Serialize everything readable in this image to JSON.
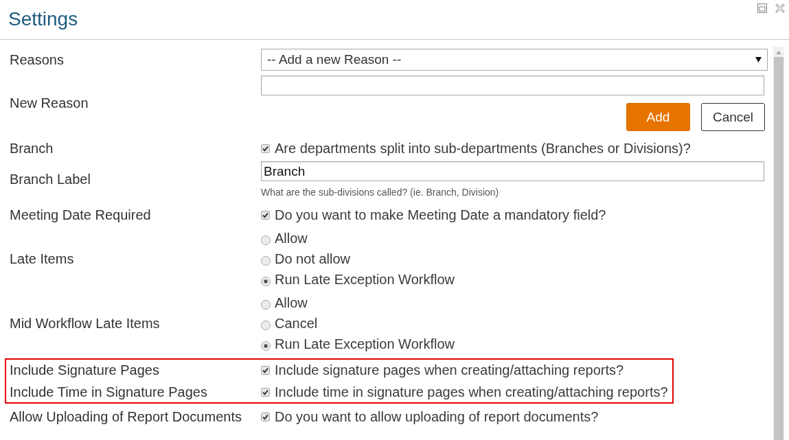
{
  "window": {
    "title": "Settings"
  },
  "settings": [
    {
      "kind": "select",
      "label": "Reasons",
      "value": "-- Add a new Reason --",
      "highlighted": false
    },
    {
      "kind": "add_field",
      "label": "New Reason",
      "buttons": [
        {
          "label": "Add",
          "kind": "primary"
        },
        {
          "label": "Cancel",
          "kind": "secondary"
        }
      ],
      "highlighted": false
    },
    {
      "kind": "checkbox",
      "label": "Branch",
      "text": "Are departments split into sub-departments (Branches or Divisions)?",
      "checked": true,
      "highlighted": false
    },
    {
      "kind": "text",
      "label": "Branch Label",
      "value": "Branch",
      "hint": "What are the sub-divisions called? (ie. Branch, Division)",
      "highlighted": false
    },
    {
      "kind": "checkbox",
      "label": "Meeting Date Required",
      "text": "Do you want to make Meeting Date a mandatory field?",
      "checked": true,
      "highlighted": false
    },
    {
      "kind": "radio",
      "label": "Late Items",
      "options": [
        {
          "label": "Allow",
          "selected": false
        },
        {
          "label": "Do not allow",
          "selected": false
        },
        {
          "label": "Run Late Exception Workflow",
          "selected": true
        }
      ],
      "highlighted": false
    },
    {
      "kind": "radio",
      "label": "Mid Workflow Late Items",
      "options": [
        {
          "label": "Allow",
          "selected": false
        },
        {
          "label": "Cancel",
          "selected": false
        },
        {
          "label": "Run Late Exception Workflow",
          "selected": true
        }
      ],
      "highlighted": false
    },
    {
      "kind": "checkbox",
      "label": "Include Signature Pages",
      "text": "Include signature pages when creating/attaching reports?",
      "checked": true,
      "highlighted": true
    },
    {
      "kind": "checkbox",
      "label": "Include Time in Signature Pages",
      "text": "Include time in signature pages when creating/attaching reports?",
      "checked": true,
      "highlighted": true
    },
    {
      "kind": "checkbox",
      "label": "Allow Uploading of Report Documents",
      "text": "Do you want to allow uploading of report documents?",
      "checked": true,
      "highlighted": false
    }
  ]
}
